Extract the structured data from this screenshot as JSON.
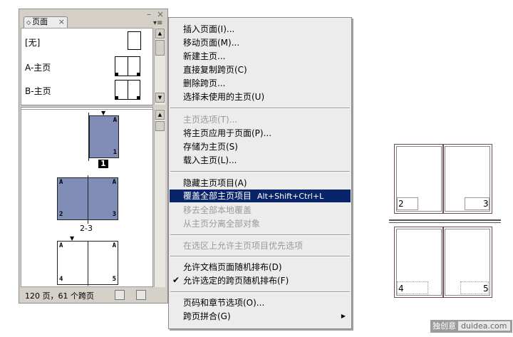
{
  "panel": {
    "tab_label": "页面",
    "tab_close": "×",
    "tab_arrow": "◇",
    "minimize": "–",
    "close": "×",
    "menu_button": "▾≡",
    "masters": [
      {
        "label": "[无]"
      },
      {
        "label": "A-主页"
      },
      {
        "label": "B-主页"
      }
    ],
    "pages": {
      "page1": {
        "left_letter": "",
        "right_letter": "A",
        "bottom_right": "1",
        "number": "1"
      },
      "spread23": {
        "left_letter": "A",
        "right_letter": "A",
        "bottom_left": "2",
        "bottom_right": "3",
        "number": "2-3"
      },
      "spread45": {
        "left_letter": "A",
        "right_letter": "A",
        "bottom_left": "4",
        "bottom_right": "5"
      }
    },
    "status": "120 页，61 个跨页"
  },
  "menu": {
    "items": [
      {
        "label": "插入页面(I)...",
        "disabled": false
      },
      {
        "label": "移动页面(M)...",
        "disabled": false
      },
      {
        "label": "新建主页...",
        "disabled": false
      },
      {
        "label": "直接复制跨页(C)",
        "disabled": false
      },
      {
        "label": "删除跨页...",
        "disabled": false
      },
      {
        "label": "选择未使用的主页(U)",
        "disabled": false
      },
      {
        "label": "主页选项(T)...",
        "disabled": true
      },
      {
        "label": "将主页应用于页面(P)...",
        "disabled": false
      },
      {
        "label": "存储为主页(S)",
        "disabled": false
      },
      {
        "label": "载入主页(L)...",
        "disabled": false
      },
      {
        "label": "隐藏主页项目(A)",
        "disabled": false
      },
      {
        "label": "覆盖全部主页项目",
        "shortcut": "Alt+Shift+Ctrl+L",
        "disabled": false,
        "highlighted": true
      },
      {
        "label": "移去全部本地覆盖",
        "disabled": true
      },
      {
        "label": "从主页分离全部对象",
        "disabled": true
      },
      {
        "label": "在选区上允许主页项目优先选项",
        "disabled": true
      },
      {
        "label": "允许文档页面随机排布(D)",
        "disabled": false
      },
      {
        "label": "允许选定的跨页随机排布(F)",
        "disabled": false,
        "checked": true
      },
      {
        "label": "页码和章节选项(O)...",
        "disabled": false
      },
      {
        "label": "跨页拼合(G)",
        "disabled": false,
        "submenu": true
      }
    ],
    "check_mark": "✔",
    "submenu_arrow": "▶"
  },
  "illustration": {
    "top_spread": {
      "left_num": "2",
      "right_num": "3"
    },
    "bottom_spread": {
      "left_num": "4",
      "right_num": "5"
    }
  },
  "watermark": {
    "brand": "独创意",
    "site": "duidea.com"
  }
}
